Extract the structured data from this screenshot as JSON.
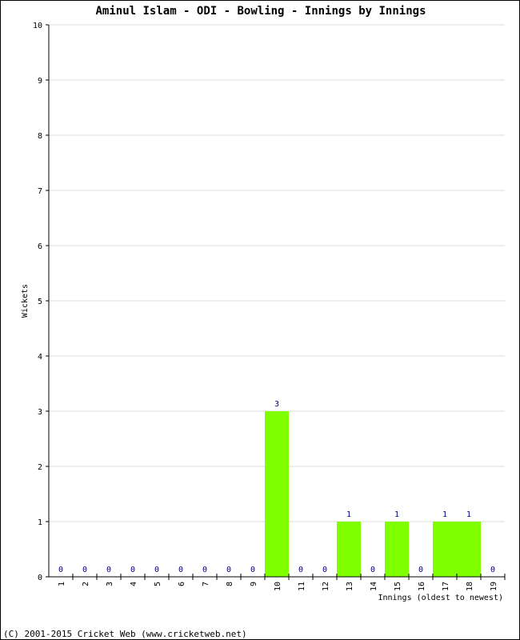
{
  "chart_data": {
    "type": "bar",
    "title": "Aminul Islam - ODI - Bowling - Innings by Innings",
    "xlabel": "Innings (oldest to newest)",
    "ylabel": "Wickets",
    "categories": [
      "1",
      "2",
      "3",
      "4",
      "5",
      "6",
      "7",
      "8",
      "9",
      "10",
      "11",
      "12",
      "13",
      "14",
      "15",
      "16",
      "17",
      "18",
      "19"
    ],
    "values": [
      0,
      0,
      0,
      0,
      0,
      0,
      0,
      0,
      0,
      3,
      0,
      0,
      1,
      0,
      1,
      0,
      1,
      1,
      0
    ],
    "ylim": [
      0,
      10
    ],
    "yticks": [
      0,
      1,
      2,
      3,
      4,
      5,
      6,
      7,
      8,
      9,
      10
    ],
    "grid": true,
    "bar_color": "#80ff00",
    "value_label_color": "#000080"
  },
  "footer": {
    "copyright": "(C) 2001-2015 Cricket Web (www.cricketweb.net)"
  }
}
